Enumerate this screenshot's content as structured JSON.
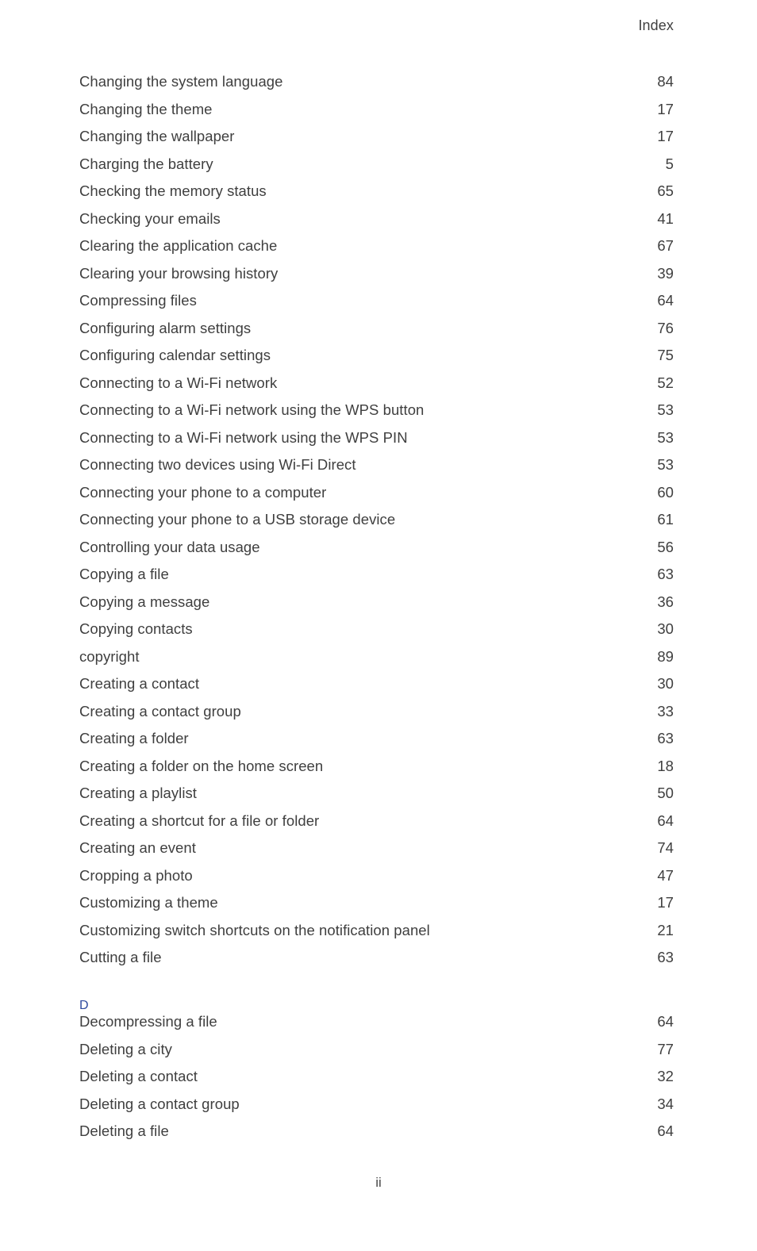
{
  "page": {
    "running_head": "Index",
    "folio": "ii"
  },
  "index": {
    "blocks": [
      {
        "type": "entries",
        "entries": [
          {
            "title": "Changing the system language",
            "page": "84"
          },
          {
            "title": "Changing the theme",
            "page": "17"
          },
          {
            "title": "Changing the wallpaper",
            "page": "17"
          },
          {
            "title": "Charging the battery",
            "page": "5"
          },
          {
            "title": "Checking the memory status",
            "page": "65"
          },
          {
            "title": "Checking your emails",
            "page": "41"
          },
          {
            "title": "Clearing the application cache",
            "page": "67"
          },
          {
            "title": "Clearing your browsing history",
            "page": "39"
          },
          {
            "title": "Compressing files",
            "page": "64"
          },
          {
            "title": "Configuring alarm settings",
            "page": "76"
          },
          {
            "title": "Configuring calendar settings",
            "page": "75"
          },
          {
            "title": "Connecting to a Wi-Fi network",
            "page": "52"
          },
          {
            "title": "Connecting to a Wi-Fi network using the WPS button",
            "page": "53"
          },
          {
            "title": "Connecting to a Wi-Fi network using the WPS PIN",
            "page": "53"
          },
          {
            "title": "Connecting two devices using Wi-Fi Direct",
            "page": "53"
          },
          {
            "title": "Connecting your phone to a computer",
            "page": "60"
          },
          {
            "title": "Connecting your phone to a USB storage device",
            "page": "61"
          },
          {
            "title": "Controlling your data usage",
            "page": "56"
          },
          {
            "title": "Copying a file",
            "page": "63"
          },
          {
            "title": "Copying a message",
            "page": "36"
          },
          {
            "title": "Copying contacts",
            "page": "30"
          },
          {
            "title": "copyright",
            "page": "89"
          },
          {
            "title": "Creating a contact",
            "page": "30"
          },
          {
            "title": "Creating a contact group",
            "page": "33"
          },
          {
            "title": "Creating a folder",
            "page": "63"
          },
          {
            "title": "Creating a folder on the home screen",
            "page": "18"
          },
          {
            "title": "Creating a playlist",
            "page": "50"
          },
          {
            "title": "Creating a shortcut for a file or folder",
            "page": "64"
          },
          {
            "title": "Creating an event",
            "page": "74"
          },
          {
            "title": "Cropping a photo",
            "page": "47"
          },
          {
            "title": "Customizing a theme",
            "page": "17"
          },
          {
            "title": "Customizing switch shortcuts on the notification panel",
            "page": "21"
          },
          {
            "title": "Cutting a file",
            "page": "63"
          }
        ]
      },
      {
        "type": "section",
        "letter": "D",
        "entries": [
          {
            "title": "Decompressing a file",
            "page": "64"
          },
          {
            "title": "Deleting a city",
            "page": "77"
          },
          {
            "title": "Deleting a contact",
            "page": "32"
          },
          {
            "title": "Deleting a contact group",
            "page": "34"
          },
          {
            "title": "Deleting a file",
            "page": "64"
          }
        ]
      }
    ]
  }
}
